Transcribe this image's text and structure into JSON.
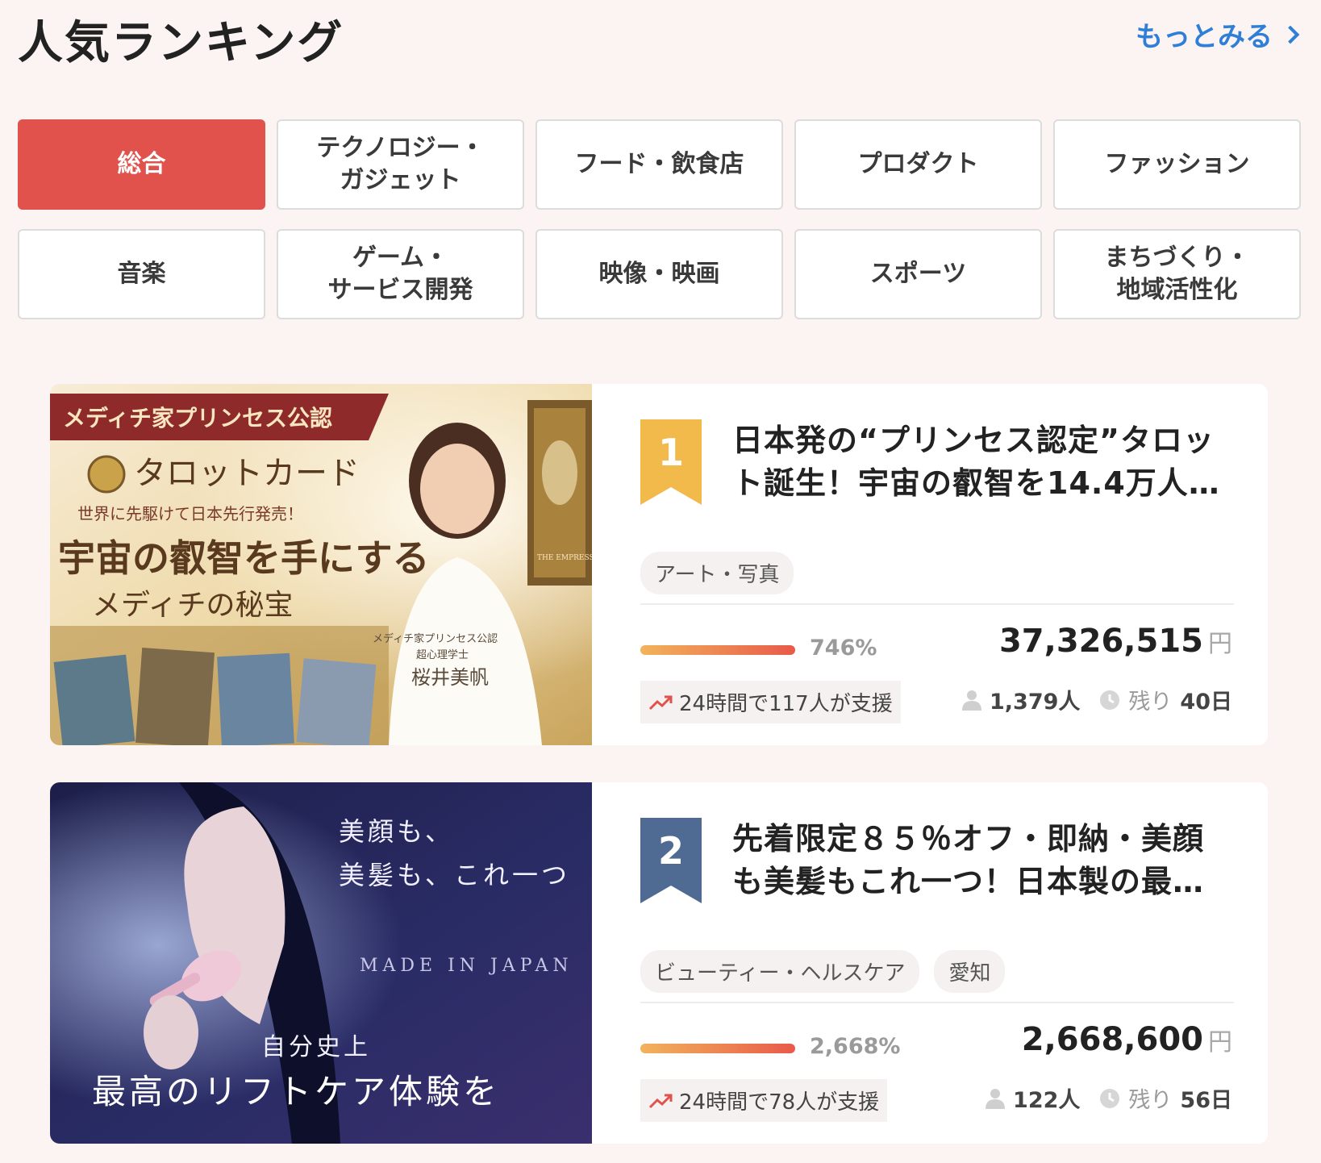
{
  "header": {
    "title": "人気ランキング",
    "more_label": "もっとみる"
  },
  "categories": [
    {
      "label": "総合",
      "active": true
    },
    {
      "label": "テクノロジー・\nガジェット",
      "active": false
    },
    {
      "label": "フード・飲食店",
      "active": false
    },
    {
      "label": "プロダクト",
      "active": false
    },
    {
      "label": "ファッション",
      "active": false
    },
    {
      "label": "音楽",
      "active": false
    },
    {
      "label": "ゲーム・\nサービス開発",
      "active": false
    },
    {
      "label": "映像・映画",
      "active": false
    },
    {
      "label": "スポーツ",
      "active": false
    },
    {
      "label": "まちづくり・\n地域活性化",
      "active": false
    }
  ],
  "colors": {
    "accent": "#e0524b",
    "link": "#2f7fd8",
    "rank_gold": "#f2b94b",
    "rank_blue": "#4f6b93"
  },
  "projects": [
    {
      "rank": "1",
      "title": "日本発の“プリンセス認定”タロット誕生！宇宙の叡智を14.4万人…",
      "tags": [
        "アート・写真"
      ],
      "progress_percent": 746,
      "progress_label": "746%",
      "amount": "37,326,515",
      "currency": "円",
      "trend_text": "24時間で117人が支援",
      "supporters": "1,379人",
      "remaining_label": "残り",
      "remaining": "40日",
      "image": {
        "banner": "メディチ家プリンセス公認",
        "product": "タロットカード",
        "tagline": "世界に先駆けて日本先行発売！",
        "headline": "宇宙の叡智を手にする",
        "subheadline": "メディチの秘宝",
        "credit_line1": "メディチ家プリンセス公認",
        "credit_line2": "超心理学士",
        "credit_name": "桜井美帆",
        "card_text": "THE EMPRESS"
      }
    },
    {
      "rank": "2",
      "title": "先着限定８５％オフ・即納・美顔も美髪もこれ一つ！日本製の最…",
      "tags": [
        "ビューティー・ヘルスケア",
        "愛知"
      ],
      "progress_percent": 2668,
      "progress_label": "2,668%",
      "amount": "2,668,600",
      "currency": "円",
      "trend_text": "24時間で78人が支援",
      "supporters": "122人",
      "remaining_label": "残り",
      "remaining": "56日",
      "image": {
        "line1": "美顔も、",
        "line2": "美髪も、これ一つ",
        "made_in": "MADE IN JAPAN",
        "line3": "自分史上",
        "line4": "最高のリフトケア体験を"
      }
    }
  ]
}
